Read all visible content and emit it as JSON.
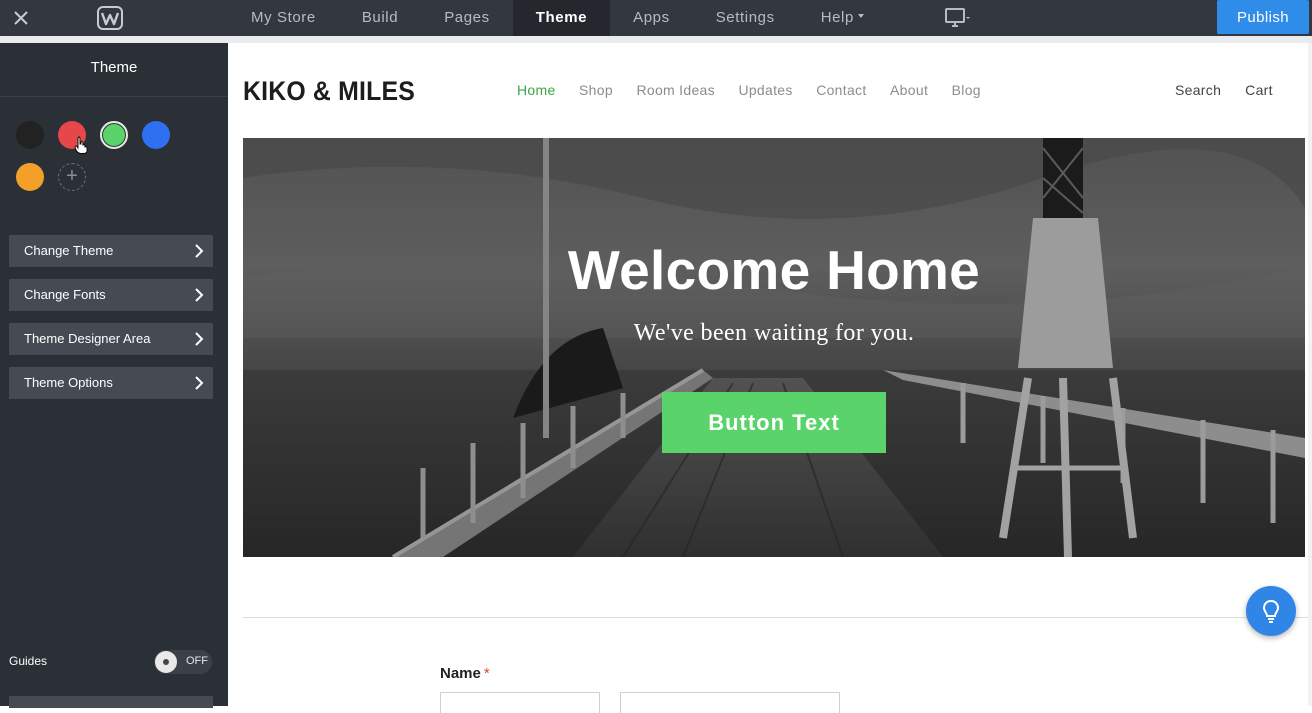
{
  "topbar": {
    "nav": [
      {
        "label": "My Store",
        "active": false,
        "caret": false
      },
      {
        "label": "Build",
        "active": false,
        "caret": false
      },
      {
        "label": "Pages",
        "active": false,
        "caret": false
      },
      {
        "label": "Theme",
        "active": true,
        "caret": false
      },
      {
        "label": "Apps",
        "active": false,
        "caret": false
      },
      {
        "label": "Settings",
        "active": false,
        "caret": false
      },
      {
        "label": "Help",
        "active": false,
        "caret": true
      }
    ],
    "publish_label": "Publish"
  },
  "sidebar": {
    "title": "Theme",
    "swatches": [
      {
        "name": "black",
        "color": "#222222"
      },
      {
        "name": "red",
        "color": "#e5474b"
      },
      {
        "name": "green",
        "color": "#5bd36b",
        "selected": true
      },
      {
        "name": "blue",
        "color": "#2f6ff2"
      },
      {
        "name": "orange",
        "color": "#f3a02a"
      }
    ],
    "menu": [
      {
        "label": "Change Theme"
      },
      {
        "label": "Change Fonts"
      },
      {
        "label": "Theme Designer Area"
      },
      {
        "label": "Theme Options"
      }
    ],
    "guides_label": "Guides",
    "guides_toggle": "OFF"
  },
  "site": {
    "brand": "KIKO & MILES",
    "nav": [
      {
        "label": "Home",
        "active": true
      },
      {
        "label": "Shop"
      },
      {
        "label": "Room Ideas"
      },
      {
        "label": "Updates"
      },
      {
        "label": "Contact"
      },
      {
        "label": "About"
      },
      {
        "label": "Blog"
      }
    ],
    "search_label": "Search",
    "cart_label": "Cart",
    "hero": {
      "title": "Welcome Home",
      "subtitle": "We've been waiting for you.",
      "button_label": "Button Text"
    },
    "form": {
      "name_label": "Name",
      "required_mark": "*"
    }
  },
  "colors": {
    "accent_green": "#3aa544",
    "button_green": "#5bd36b",
    "publish_blue": "#2f8ce8",
    "sidebar_bg": "#2b2f36",
    "topbar_bg": "#323740"
  }
}
